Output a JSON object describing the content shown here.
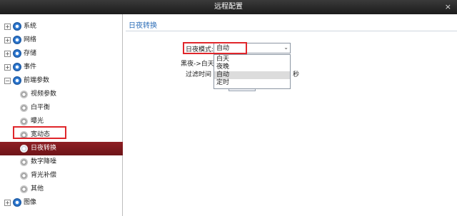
{
  "window": {
    "title": "远程配置",
    "close_glyph": "×"
  },
  "sidebar": {
    "items": [
      {
        "label": "系统",
        "expander": "+",
        "level": 0
      },
      {
        "label": "网络",
        "expander": "+",
        "level": 0
      },
      {
        "label": "存储",
        "expander": "+",
        "level": 0
      },
      {
        "label": "事件",
        "expander": "+",
        "level": 0
      },
      {
        "label": "前端参数",
        "expander": "−",
        "level": 0
      },
      {
        "label": "视频参数",
        "level": 1
      },
      {
        "label": "白平衡",
        "level": 1
      },
      {
        "label": "曝光",
        "level": 1
      },
      {
        "label": "宽动态",
        "level": 1
      },
      {
        "label": "日夜转换",
        "level": 1,
        "selected": true
      },
      {
        "label": "数字降噪",
        "level": 1
      },
      {
        "label": "背光补偿",
        "level": 1
      },
      {
        "label": "其他",
        "level": 1
      },
      {
        "label": "图像",
        "expander": "+",
        "level": 0
      }
    ]
  },
  "panel": {
    "title": "日夜转换",
    "fields": {
      "mode_label": "日夜模式:",
      "mode_value": "自动",
      "dark_to_day_label": "黑夜->白天:",
      "filter_time_label": "过滤时间",
      "seconds_unit": "秒"
    },
    "dropdown_options": [
      "白天",
      "夜晚",
      "自动",
      "定时"
    ],
    "dropdown_selected": "自动"
  },
  "colors": {
    "accent_red": "#e0262b",
    "selected_bg": "#7a171c",
    "title_blue": "#2f6fb8"
  },
  "icons": {
    "node": "gear-icon",
    "dropdown": "chevron-down-icon"
  }
}
